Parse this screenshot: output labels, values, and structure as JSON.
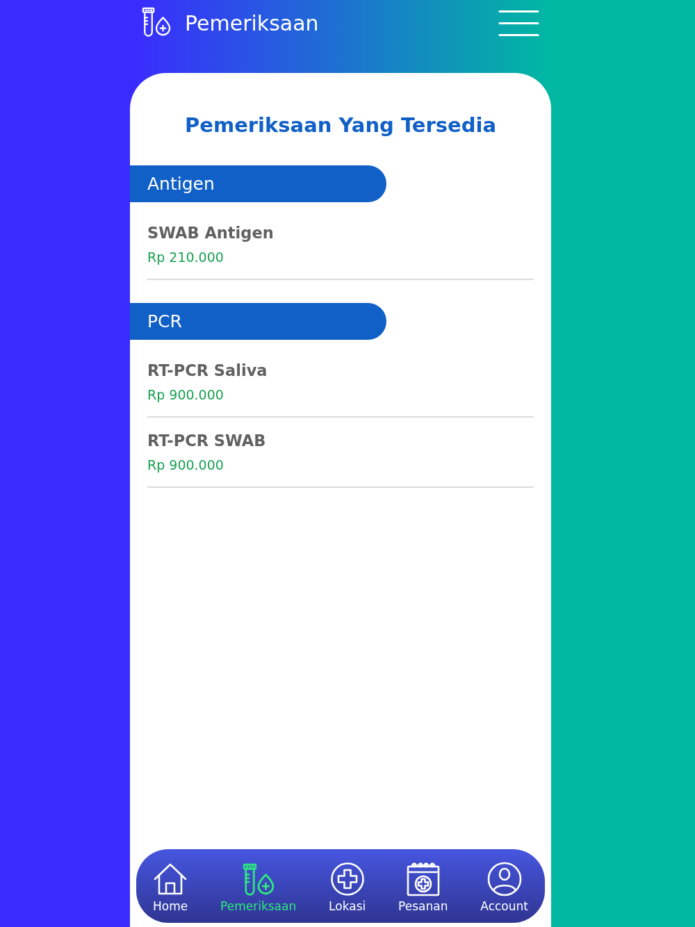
{
  "header": {
    "title": "Pemeriksaan"
  },
  "page_title": "Pemeriksaan Yang Tersedia",
  "categories": [
    {
      "name": "Antigen",
      "tests": [
        {
          "name": "SWAB Antigen",
          "price": "Rp 210.000"
        }
      ]
    },
    {
      "name": "PCR",
      "tests": [
        {
          "name": "RT-PCR Saliva",
          "price": "Rp 900.000"
        },
        {
          "name": "RT-PCR SWAB",
          "price": "Rp 900.000"
        }
      ]
    }
  ],
  "bottom_nav": [
    {
      "label": "Home",
      "kind": "home",
      "selected": false
    },
    {
      "label": "Pemeriksaan",
      "kind": "tests",
      "selected": true
    },
    {
      "label": "Lokasi",
      "kind": "location",
      "selected": false
    },
    {
      "label": "Pesanan",
      "kind": "orders",
      "selected": false
    },
    {
      "label": "Account",
      "kind": "account",
      "selected": false
    }
  ]
}
